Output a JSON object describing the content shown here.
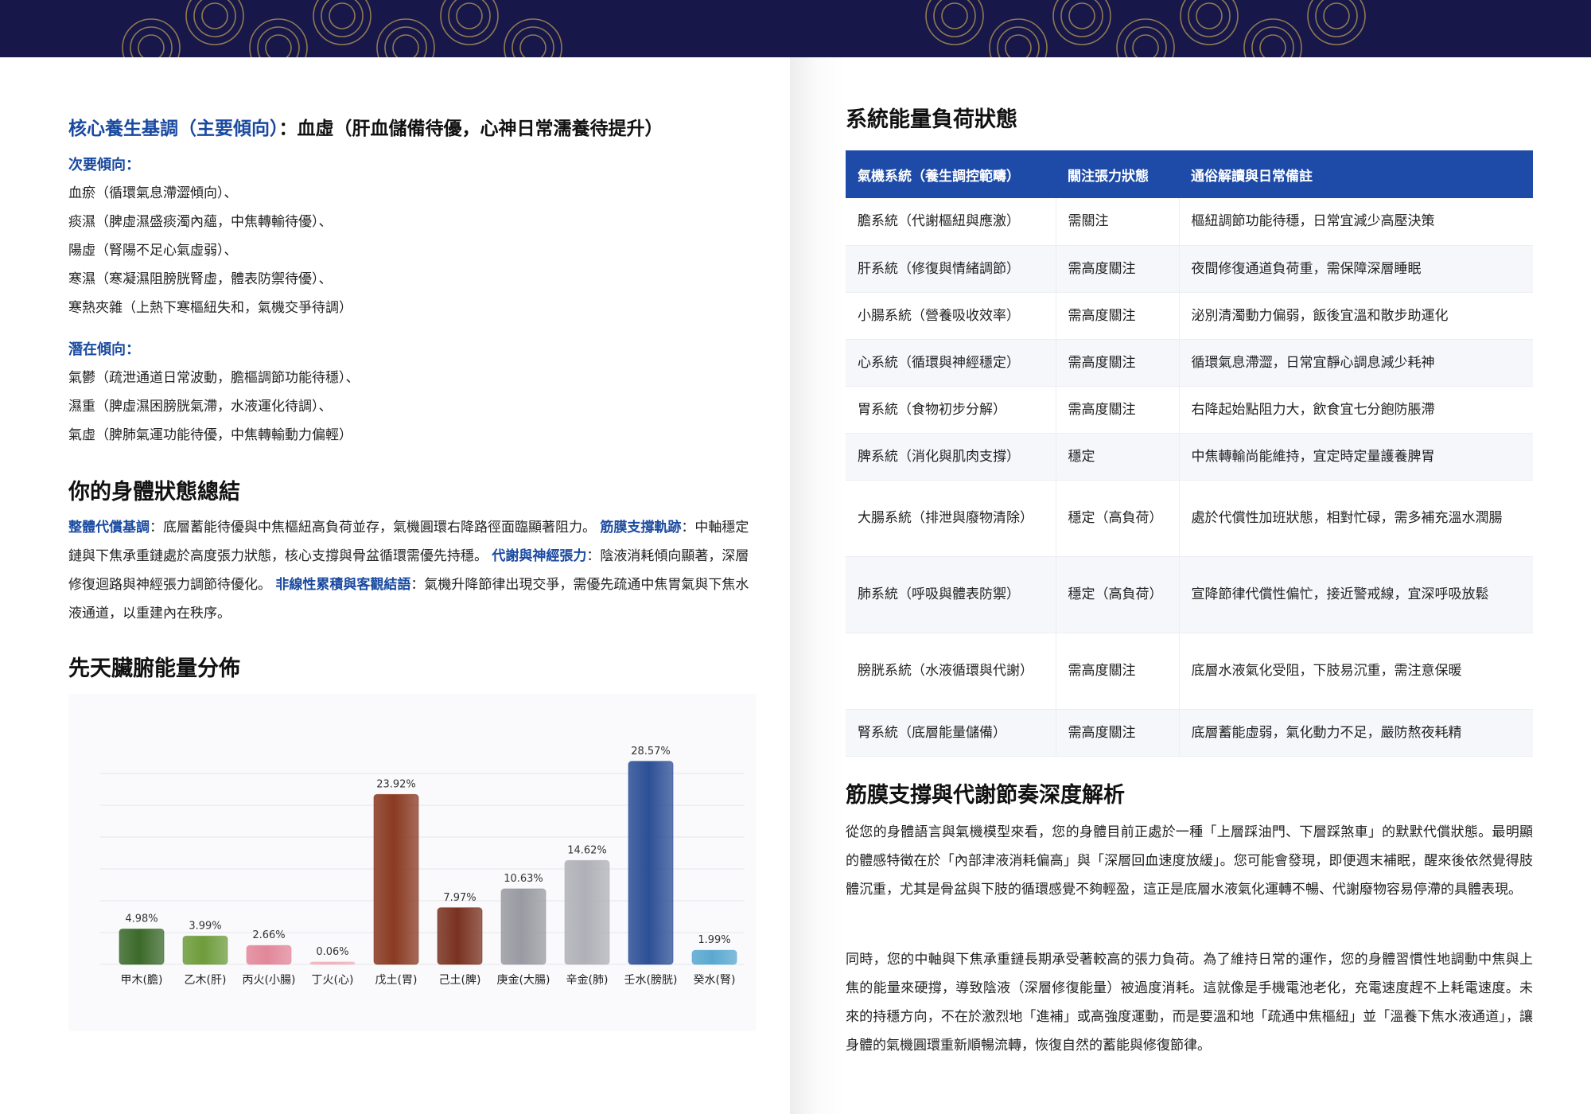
{
  "colors": {
    "band": "#17174a",
    "accent": "#1a4aa0",
    "table_header": "#1e4ba8"
  },
  "core": {
    "label": "核心養生基調（主要傾向）",
    "value": "：血虛（肝血儲備待優，心神日常濡養待提升）"
  },
  "secondary": {
    "label": "次要傾向：",
    "items": [
      "血瘀（循環氣息滯澀傾向）、",
      "痰濕（脾虛濕盛痰濁內蘊，中焦轉輸待優）、",
      "陽虛（腎陽不足心氣虛弱）、",
      "寒濕（寒凝濕阻膀胱腎虛，體表防禦待優）、",
      "寒熱夾雜（上熱下寒樞紐失和，氣機交爭待調）"
    ]
  },
  "potential": {
    "label": "潛在傾向：",
    "items": [
      "氣鬱（疏泄通道日常波動，膽樞調節功能待穩）、",
      "濕重（脾虛濕困膀胱氣滯，水液運化待調）、",
      "氣虛（脾肺氣運功能待優，中焦轉輸動力偏輕）"
    ]
  },
  "summary": {
    "title": "你的身體狀態總結",
    "k1": "整體代償基調",
    "t1": "：底層蓄能待優與中焦樞紐高負荷並存，氣機圓環右降路徑面臨顯著阻力。",
    "k2": "筋膜支撐軌跡",
    "t2": "：中軸穩定鏈與下焦承重鏈處於高度張力狀態，核心支撐與骨盆循環需優先持穩。",
    "k3": "代謝與神經張力",
    "t3": "：陰液消耗傾向顯著，深層修復迴路與神經張力調節待優化。",
    "k4": "非線性累積與客觀結語",
    "t4": "：氣機升降節律出現交爭，需優先疏通中焦胃氣與下焦水液通道，以重建內在秩序。"
  },
  "chart_title": "先天臟腑能量分佈",
  "chart_data": {
    "type": "bar",
    "categories": [
      "甲木(膽)",
      "乙木(肝)",
      "丙火(小腸)",
      "丁火(心)",
      "戊土(胃)",
      "己土(脾)",
      "庚金(大腸)",
      "辛金(肺)",
      "壬水(膀胱)",
      "癸水(腎)"
    ],
    "values": [
      4.98,
      3.99,
      2.66,
      0.06,
      23.92,
      7.97,
      10.63,
      14.62,
      28.57,
      1.99
    ],
    "value_labels": [
      "4.98%",
      "3.99%",
      "2.66%",
      "0.06%",
      "23.92%",
      "7.97%",
      "10.63%",
      "14.62%",
      "28.57%",
      "1.99%"
    ],
    "colors": [
      "#3c6a2a",
      "#6e9c3c",
      "#e2879a",
      "#f0b2bc",
      "#8a3a22",
      "#7a3220",
      "#9a9aa2",
      "#b0b0b8",
      "#2c4f96",
      "#5aa8d0"
    ],
    "ylim": [
      0,
      30
    ],
    "grid": true
  },
  "table": {
    "title": "系統能量負荷狀態",
    "headers": [
      "氣機系統（養生調控範疇）",
      "關注張力狀態",
      "通俗解讀與日常備註"
    ],
    "rows": [
      [
        "膽系統（代謝樞紐與應激）",
        "需關注",
        "樞紐調節功能待穩，日常宜減少高壓決策"
      ],
      [
        "肝系統（修復與情緒調節）",
        "需高度關注",
        "夜間修復通道負荷重，需保障深層睡眠"
      ],
      [
        "小腸系統（營養吸收效率）",
        "需高度關注",
        "泌別清濁動力偏弱，飯後宜溫和散步助運化"
      ],
      [
        "心系統（循環與神經穩定）",
        "需高度關注",
        "循環氣息滯澀，日常宜靜心調息減少耗神"
      ],
      [
        "胃系統（食物初步分解）",
        "需高度關注",
        "右降起始點阻力大，飲食宜七分飽防脹滯"
      ],
      [
        "脾系統（消化與肌肉支撐）",
        "穩定",
        "中焦轉輸尚能維持，宜定時定量護養脾胃"
      ],
      [
        "大腸系統（排泄與廢物清除）",
        "穩定（高負荷）",
        "處於代償性加班狀態，相對忙碌，需多補充溫水潤腸"
      ],
      [
        "肺系統（呼吸與體表防禦）",
        "穩定（高負荷）",
        "宣降節律代償性偏忙，接近警戒線，宜深呼吸放鬆"
      ],
      [
        "膀胱系統（水液循環與代謝）",
        "需高度關注",
        "底層水液氣化受阻，下肢易沉重，需注意保暖"
      ],
      [
        "腎系統（底層能量儲備）",
        "需高度關注",
        "底層蓄能虛弱，氣化動力不足，嚴防熬夜耗精"
      ]
    ]
  },
  "analysis": {
    "title": "筋膜支撐與代謝節奏深度解析",
    "p1": "從您的身體語言與氣機模型來看，您的身體目前正處於一種「上層踩油門、下層踩煞車」的默默代償狀態。最明顯的體感特徵在於「內部津液消耗偏高」與「深層回血速度放緩」。您可能會發現，即便週末補眠，醒來後依然覺得肢體沉重，尤其是骨盆與下肢的循環感覺不夠輕盈，這正是底層水液氣化運轉不暢、代謝廢物容易停滯的具體表現。",
    "p2": "同時，您的中軸與下焦承重鏈長期承受著較高的張力負荷。為了維持日常的運作，您的身體習慣性地調動中焦與上焦的能量來硬撐，導致陰液（深層修復能量）被過度消耗。這就像是手機電池老化，充電速度趕不上耗電速度。未來的持穩方向，不在於激烈地「進補」或高強度運動，而是要溫和地「疏通中焦樞紐」並「溫養下焦水液通道」，讓身體的氣機圓環重新順暢流轉，恢復自然的蓄能與修復節律。"
  }
}
